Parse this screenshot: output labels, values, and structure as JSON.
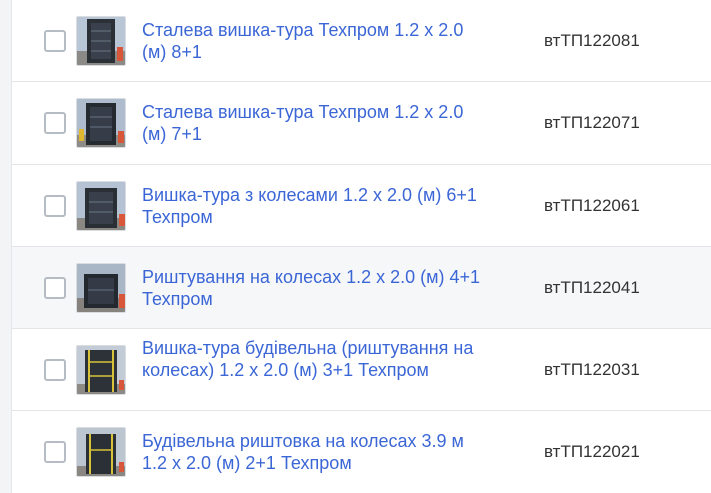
{
  "products": [
    {
      "name": "Сталева вишка-тура Техпром 1.2 х 2.0 (м) 8+1",
      "code": "втТП122081",
      "image": "scaffold-tower-photo"
    },
    {
      "name": "Сталева вишка-тура Техпром 1.2 х 2.0 (м) 7+1",
      "code": "втТП122071",
      "image": "scaffold-tower-photo"
    },
    {
      "name": "Вишка-тура з колесами 1.2 х 2.0 (м) 6+1 Техпром",
      "code": "втТП122061",
      "image": "scaffold-tower-photo"
    },
    {
      "name": "Риштування на колесах 1.2 х 2.0 (м) 4+1 Техпром",
      "code": "втТП122041",
      "image": "scaffold-tower-photo"
    },
    {
      "name": "Вишка-тура будівельна (риштування на колесах) 1.2 х 2.0 (м) 3+1 Техпром",
      "code": "втТП122031",
      "image": "scaffold-tower-photo"
    },
    {
      "name": "Будівельна риштовка на колесах 3.9 м 1.2 х 2.0 (м) 2+1 Техпром",
      "code": "втТП122021",
      "image": "scaffold-tower-photo"
    }
  ]
}
